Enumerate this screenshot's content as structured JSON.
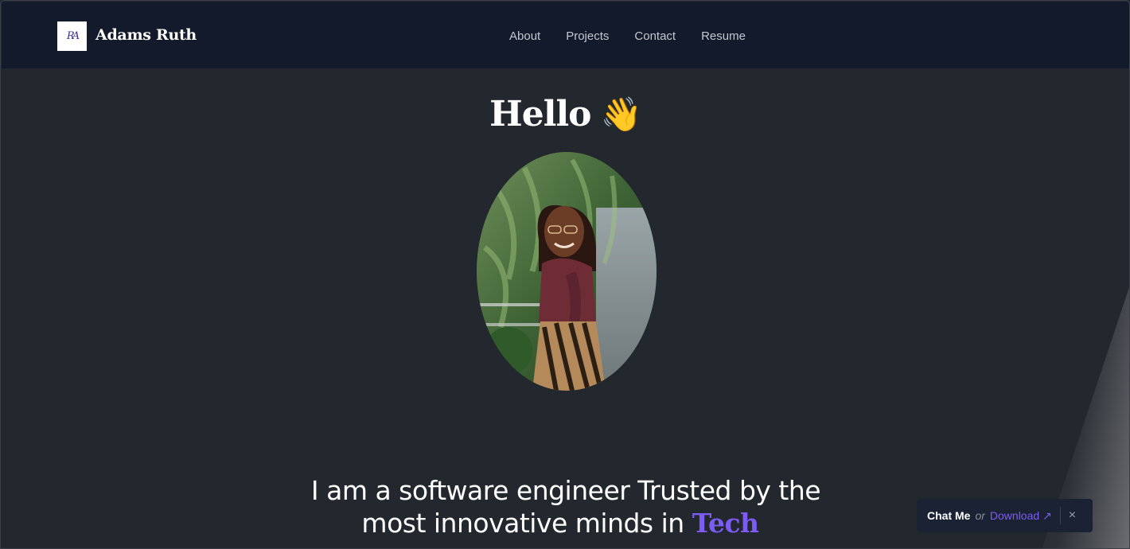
{
  "brand": {
    "logo_text": "RA",
    "name": "Adams Ruth"
  },
  "nav": {
    "items": [
      {
        "label": "About"
      },
      {
        "label": "Projects"
      },
      {
        "label": "Contact"
      },
      {
        "label": "Resume"
      }
    ]
  },
  "hero": {
    "greeting": "Hello",
    "wave_emoji": "👋",
    "portrait_icon": "portrait-photo",
    "tagline_line1": "I am a software engineer Trusted by the",
    "tagline_line2": "most innovative minds in",
    "tagline_accent": "Tech"
  },
  "chat_widget": {
    "chat_label": "Chat Me",
    "or_text": "or",
    "download_label": "Download ↗",
    "close_icon": "×"
  },
  "colors": {
    "background": "#23272e",
    "navbar": "#121a2b",
    "accent": "#7c5cf5",
    "widget": "#1a2233"
  }
}
